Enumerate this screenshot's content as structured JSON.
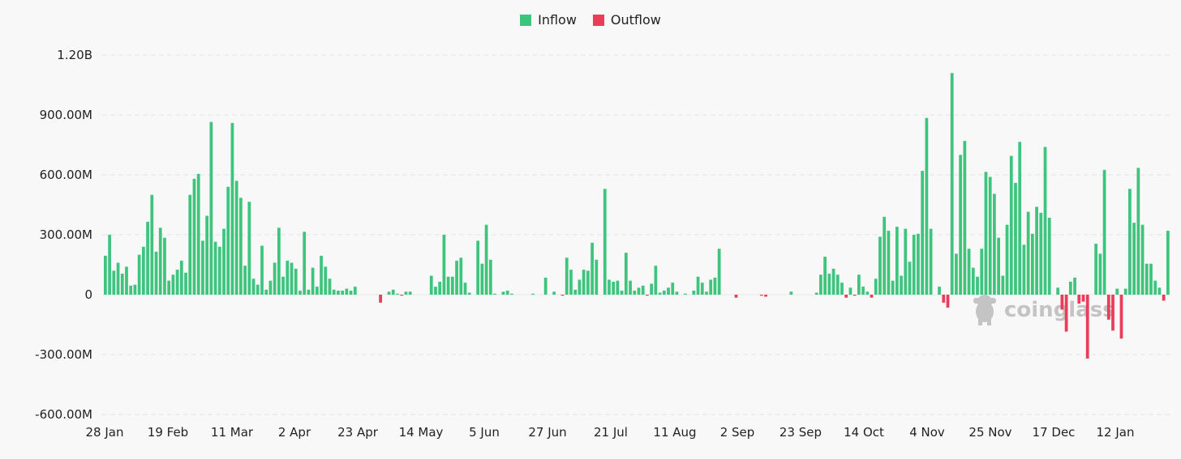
{
  "chart_data": {
    "type": "bar",
    "title": "",
    "xlabel": "",
    "ylabel": "",
    "ylim": [
      -600000000,
      1200000000
    ],
    "yticks": [
      {
        "value": 1200000000,
        "label": "1.20B"
      },
      {
        "value": 900000000,
        "label": "900.00M"
      },
      {
        "value": 600000000,
        "label": "600.00M"
      },
      {
        "value": 300000000,
        "label": "300.00M"
      },
      {
        "value": 0,
        "label": "0"
      },
      {
        "value": -300000000,
        "label": "-300.00M"
      },
      {
        "value": -600000000,
        "label": "-600.00M"
      }
    ],
    "xticks": [
      "28 Jan",
      "19 Feb",
      "11 Mar",
      "2 Apr",
      "23 Apr",
      "14 May",
      "5 Jun",
      "27 Jun",
      "21 Jul",
      "11 Aug",
      "2 Sep",
      "23 Sep",
      "14 Oct",
      "4 Nov",
      "25 Nov",
      "17 Dec",
      "12 Jan"
    ],
    "grid": true,
    "legend": {
      "position": "top-center",
      "entries": [
        {
          "name": "Inflow",
          "color": "#3fc47e"
        },
        {
          "name": "Outflow",
          "color": "#ea3d5a"
        }
      ]
    },
    "series_note": "Daily net flow in millions USD; positive = Inflow, negative = Outflow; null = no trading day",
    "values_musd": [
      195,
      300,
      120,
      160,
      105,
      140,
      45,
      50,
      200,
      240,
      365,
      500,
      215,
      335,
      285,
      70,
      100,
      125,
      170,
      110,
      500,
      580,
      605,
      270,
      395,
      865,
      265,
      240,
      330,
      540,
      860,
      570,
      485,
      145,
      465,
      80,
      50,
      245,
      25,
      70,
      160,
      335,
      90,
      170,
      160,
      130,
      20,
      315,
      25,
      135,
      40,
      195,
      140,
      80,
      25,
      20,
      20,
      30,
      20,
      40,
      0,
      0,
      0,
      0,
      0,
      -40,
      0,
      15,
      25,
      5,
      -5,
      15,
      15,
      0,
      0,
      0,
      0,
      95,
      40,
      65,
      300,
      90,
      90,
      170,
      185,
      60,
      10,
      0,
      270,
      155,
      350,
      175,
      5,
      0,
      15,
      20,
      5,
      0,
      0,
      0,
      0,
      5,
      0,
      0,
      85,
      0,
      15,
      0,
      -5,
      185,
      125,
      25,
      75,
      125,
      120,
      260,
      175,
      0,
      530,
      75,
      65,
      70,
      20,
      210,
      70,
      20,
      35,
      45,
      -5,
      55,
      145,
      10,
      20,
      35,
      60,
      15,
      0,
      5,
      0,
      20,
      90,
      60,
      15,
      75,
      85,
      230,
      0,
      0,
      0,
      -15,
      0,
      0,
      0,
      0,
      0,
      -5,
      -10,
      0,
      0,
      0,
      0,
      0,
      15,
      0,
      0,
      0,
      0,
      0,
      10,
      100,
      190,
      105,
      130,
      100,
      60,
      -15,
      35,
      -5,
      100,
      40,
      15,
      -15,
      80,
      290,
      390,
      320,
      70,
      340,
      95,
      330,
      165,
      300,
      305,
      620,
      885,
      330,
      0,
      40,
      -40,
      -65,
      1110,
      205,
      700,
      770,
      230,
      135,
      90,
      230,
      615,
      590,
      505,
      285,
      95,
      350,
      695,
      560,
      765,
      250,
      415,
      305,
      440,
      410,
      740,
      385,
      0,
      35,
      -75,
      -185,
      65,
      85,
      -45,
      -35,
      -320,
      0,
      255,
      205,
      625,
      -125,
      -180,
      30,
      -220,
      30,
      530,
      360,
      635,
      350,
      155,
      155,
      70,
      35,
      -30,
      320
    ]
  }
}
